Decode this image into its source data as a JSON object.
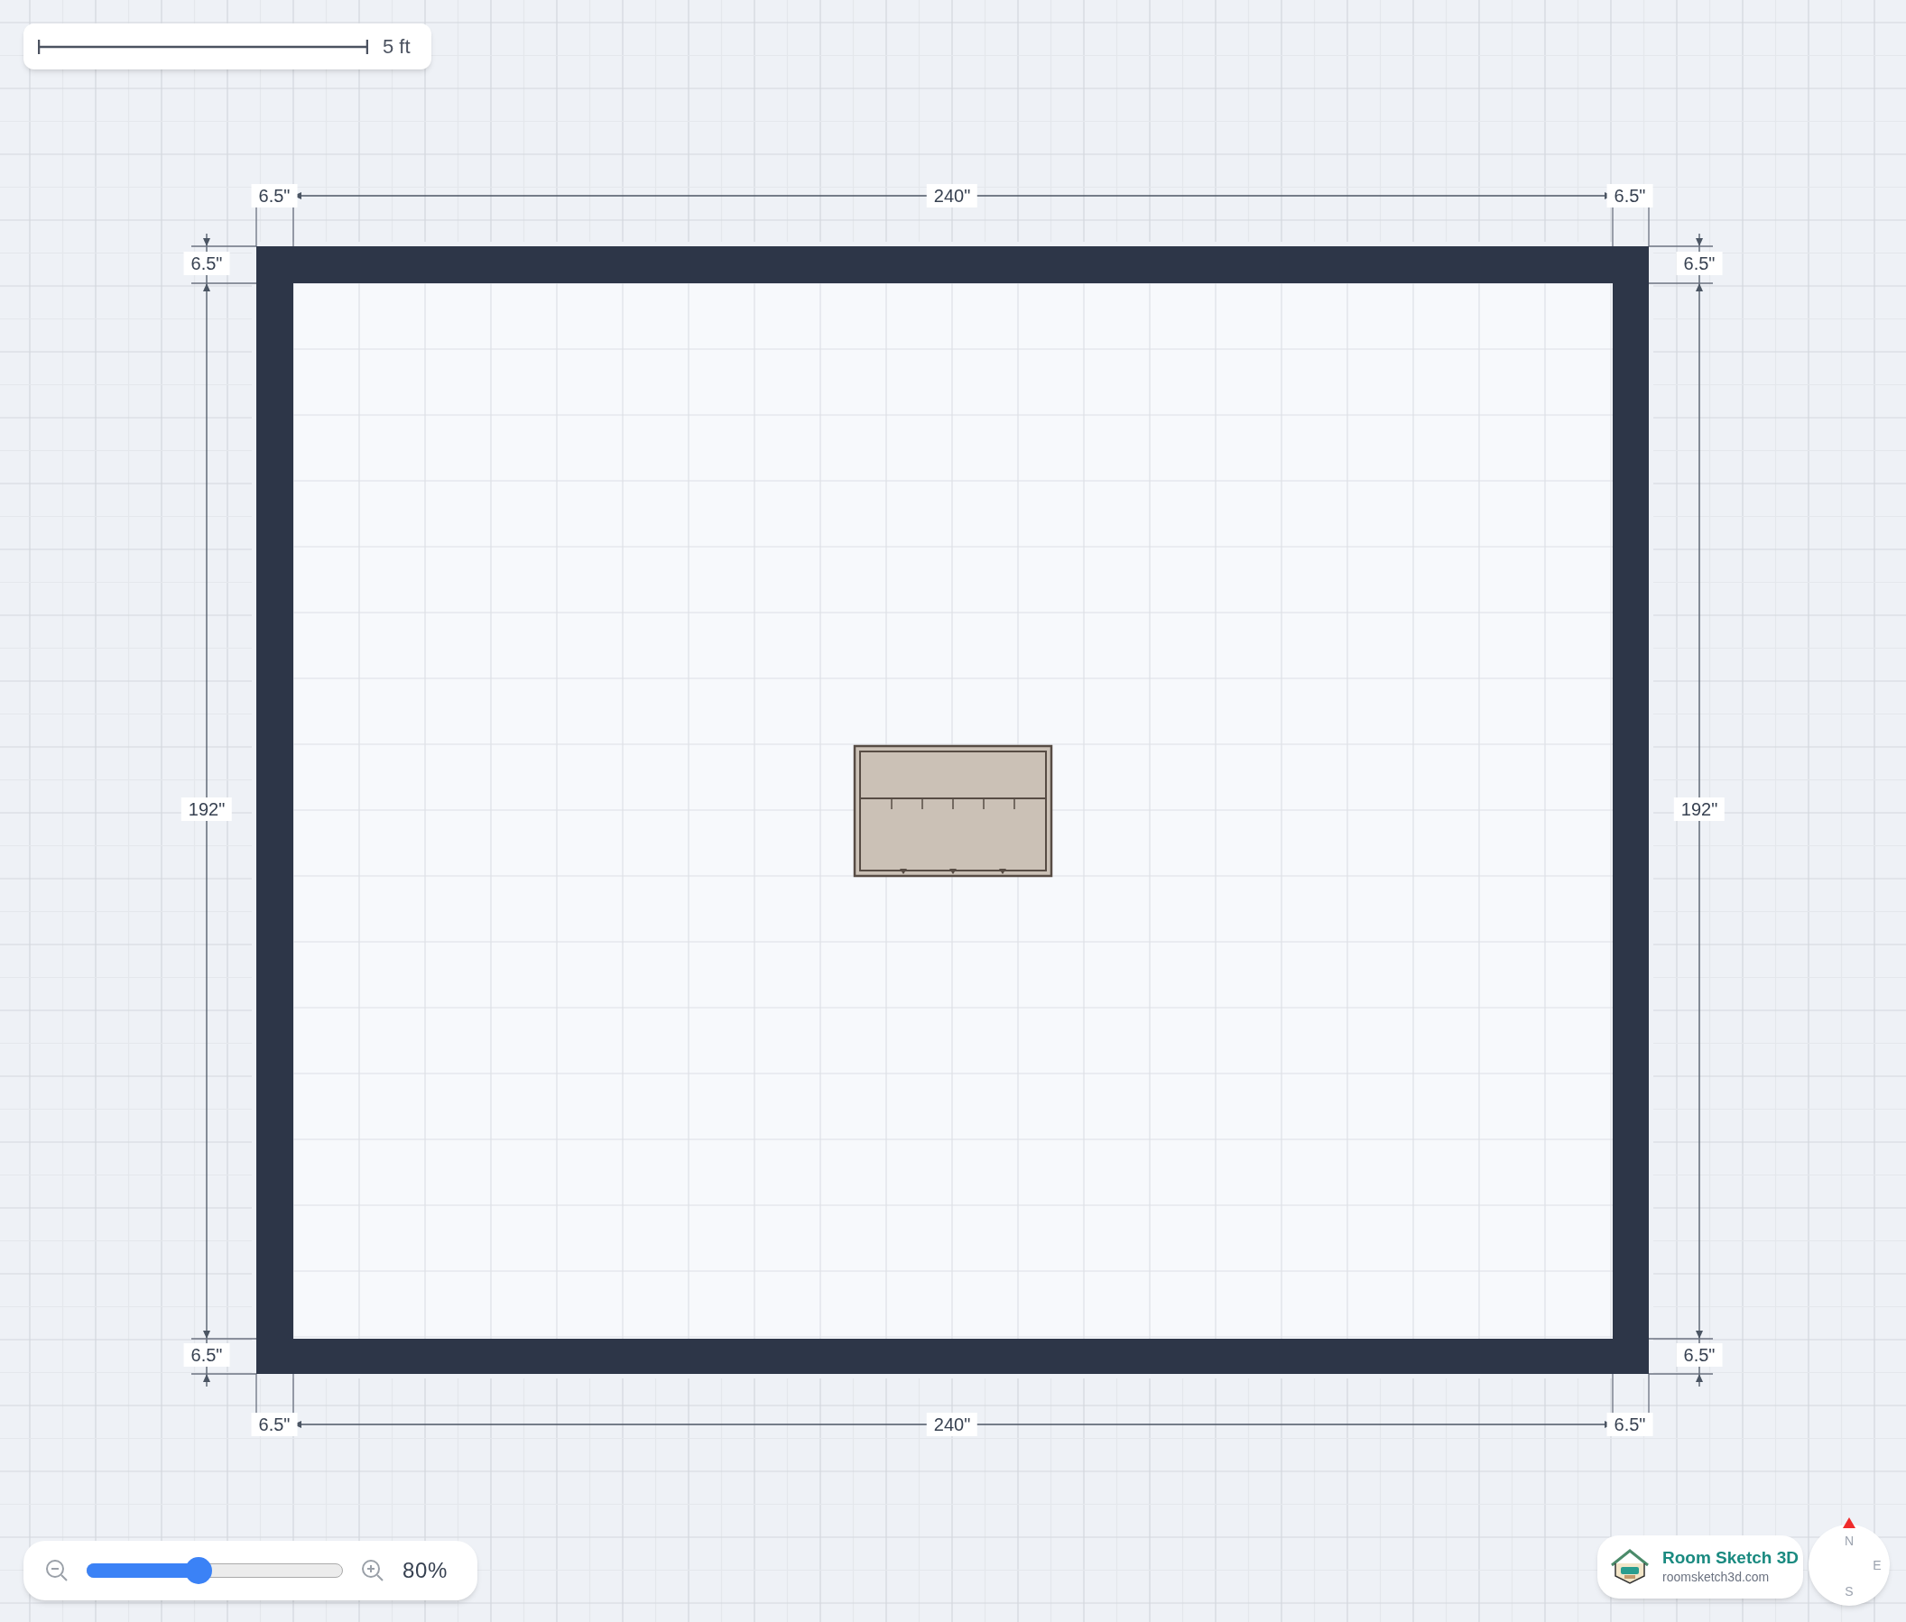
{
  "scale_bar": {
    "label": "5 ft"
  },
  "dimensions": {
    "top": [
      "6.5\"",
      "240\"",
      "6.5\""
    ],
    "left": [
      "6.5\"",
      "192\"",
      "6.5\""
    ],
    "right": [
      "6.5\"",
      "192\"",
      "6.5\""
    ],
    "bottom": [
      "6.5\"",
      "240\"",
      "6.5\""
    ]
  },
  "zoom": {
    "level": 0.43,
    "reading": "80%"
  },
  "compass": {
    "labels": [
      "N",
      "E",
      "S"
    ]
  },
  "brand": {
    "title": "Room Sketch 3D",
    "url": "roomsketch3d.com"
  }
}
